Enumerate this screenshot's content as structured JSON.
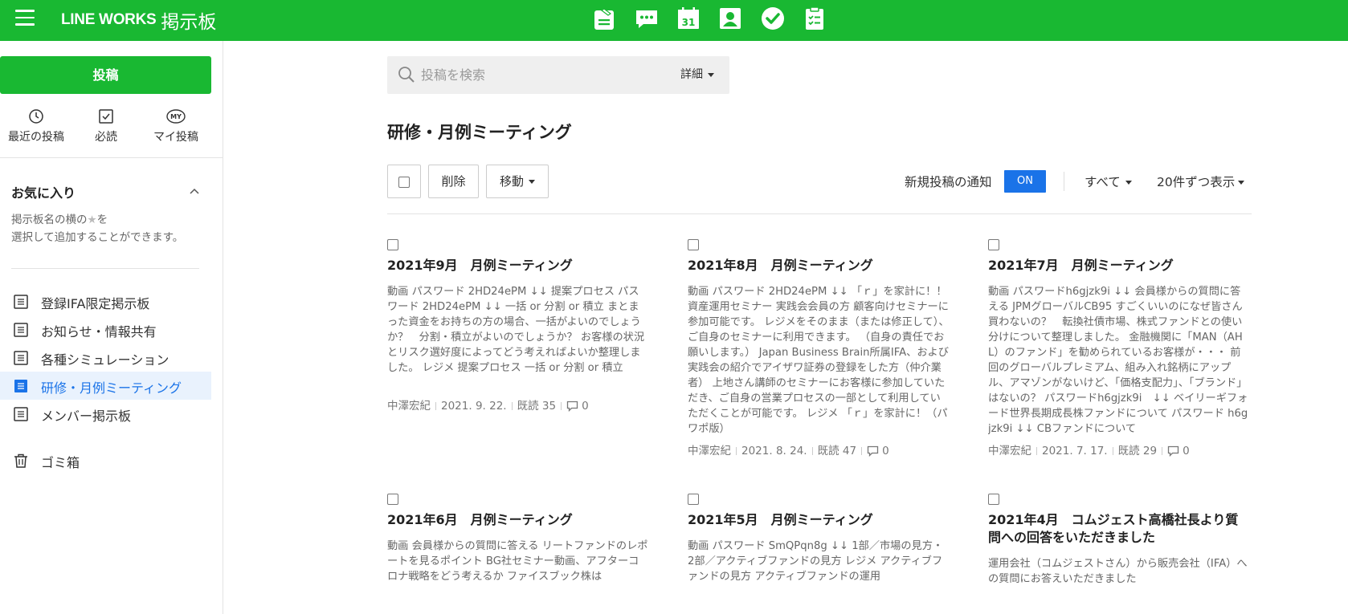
{
  "header": {
    "logo": "LINE WORKS",
    "app_name": "掲示板",
    "icons": [
      "board-icon",
      "chat-icon",
      "calendar-icon",
      "contacts-icon",
      "task-icon",
      "form-icon"
    ],
    "calendar_day": "31"
  },
  "sidebar": {
    "post_button": "投稿",
    "quick": [
      {
        "label": "最近の投稿",
        "icon": "clock-icon"
      },
      {
        "label": "必読",
        "icon": "check-square-icon"
      },
      {
        "label": "マイ投稿",
        "icon": "my-icon",
        "badge": "MY"
      }
    ],
    "favorites": {
      "title": "お気に入り",
      "desc_1": "掲示板名の横の",
      "star": "★",
      "desc_2": "を",
      "desc_3": "選択して追加することができます。"
    },
    "boards": [
      {
        "label": "登録IFA限定掲示板",
        "active": false
      },
      {
        "label": "お知らせ・情報共有",
        "active": false
      },
      {
        "label": "各種シミュレーション",
        "active": false
      },
      {
        "label": "研修・月例ミーティング",
        "active": true
      },
      {
        "label": "メンバー掲示板",
        "active": false
      }
    ],
    "trash": "ゴミ箱"
  },
  "main": {
    "search": {
      "placeholder": "投稿を検索",
      "detail": "詳細"
    },
    "title": "研修・月例ミーティング",
    "toolbar": {
      "delete": "削除",
      "move": "移動"
    },
    "notice_label": "新規投稿の通知",
    "notice_toggle": "ON",
    "filter_all": "すべて",
    "per_page": "20件ずつ表示"
  },
  "posts": [
    {
      "title": "2021年9月　月例ミーティング",
      "body": "動画 パスワード 2HD24ePM ↓↓ 提案プロセス パスワード 2HD24ePM ↓↓ 一括 or 分割 or 積立 まとまった資金をお持ちの方の場合、一括がよいのでしょうか？　分割・積立がよいのでしょうか？ お客様の状況とリスク選好度によってどう考えればよいか整理しました。 レジメ 提案プロセス 一括 or 分割 or 積立",
      "author": "中澤宏紀",
      "date": "2021. 9. 22.",
      "reads": "既読 35",
      "comments": "0"
    },
    {
      "title": "2021年8月　月例ミーティング",
      "body": "動画 パスワード 2HD24ePM ↓↓ 「ｒ」を家計に！！ 資産運用セミナー 実践会会員の方 顧客向けセミナーに参加可能です。 レジメをそのまま（または修正して）、ご自身のセミナーに利用できます。 （自身の責任でお願いします。） Japan Business Brain所属IFA、および実践会の紹介でアイザワ証券の登録をした方（仲介業者） 上地さん講師のセミナーにお客様に参加していただき、ご自身の営業プロセスの一部として利用していただくことが可能です。 レジメ 「ｒ」を家計に！（パワポ版）",
      "author": "中澤宏紀",
      "date": "2021. 8. 24.",
      "reads": "既読 47",
      "comments": "0"
    },
    {
      "title": "2021年7月　月例ミーティング",
      "body": "動画 パスワードh6gjzk9i ↓↓ 会員様からの質問に答える JPMグローバルCB95 すごくいいのになぜ皆さん買わないの？　転換社債市場、株式ファンドとの使い分けについて整理しました。 金融機関に「MAN（AHL）のファンド」を勧められているお客様が・・・ 前回のグローバルプレミアム、組み入れ銘柄にアップル、アマゾンがないけど、「価格支配力」、「ブランド」はないの？ パスワードh6gjzk9i　↓↓ ベイリーギフォード世界長期成長株ファンドについて パスワード h6gjzk9i ↓↓ CBファンドについて",
      "author": "中澤宏紀",
      "date": "2021. 7. 17.",
      "reads": "既読 29",
      "comments": "0"
    },
    {
      "title": "2021年6月　月例ミーティング",
      "body": "動画 会員様からの質問に答える リートファンドのレポートを見るポイント BG社セミナー動画、アフターコロナ戦略をどう考えるか ファイスブック株は",
      "author": "",
      "date": "",
      "reads": "",
      "comments": ""
    },
    {
      "title": "2021年5月　月例ミーティング",
      "body": "動画 パスワード SmQPqn8g ↓↓ 1部／市場の見方・2部／アクティブファンドの見方 レジメ アクティブファンドの見方 アクティブファンドの運用",
      "author": "",
      "date": "",
      "reads": "",
      "comments": ""
    },
    {
      "title": "2021年4月　コムジェスト高橋社長より質問への回答をいただきました",
      "body": "運用会社（コムジェストさん）から販売会社（IFA）への質問にお答えいただきました",
      "author": "",
      "date": "",
      "reads": "",
      "comments": ""
    }
  ]
}
